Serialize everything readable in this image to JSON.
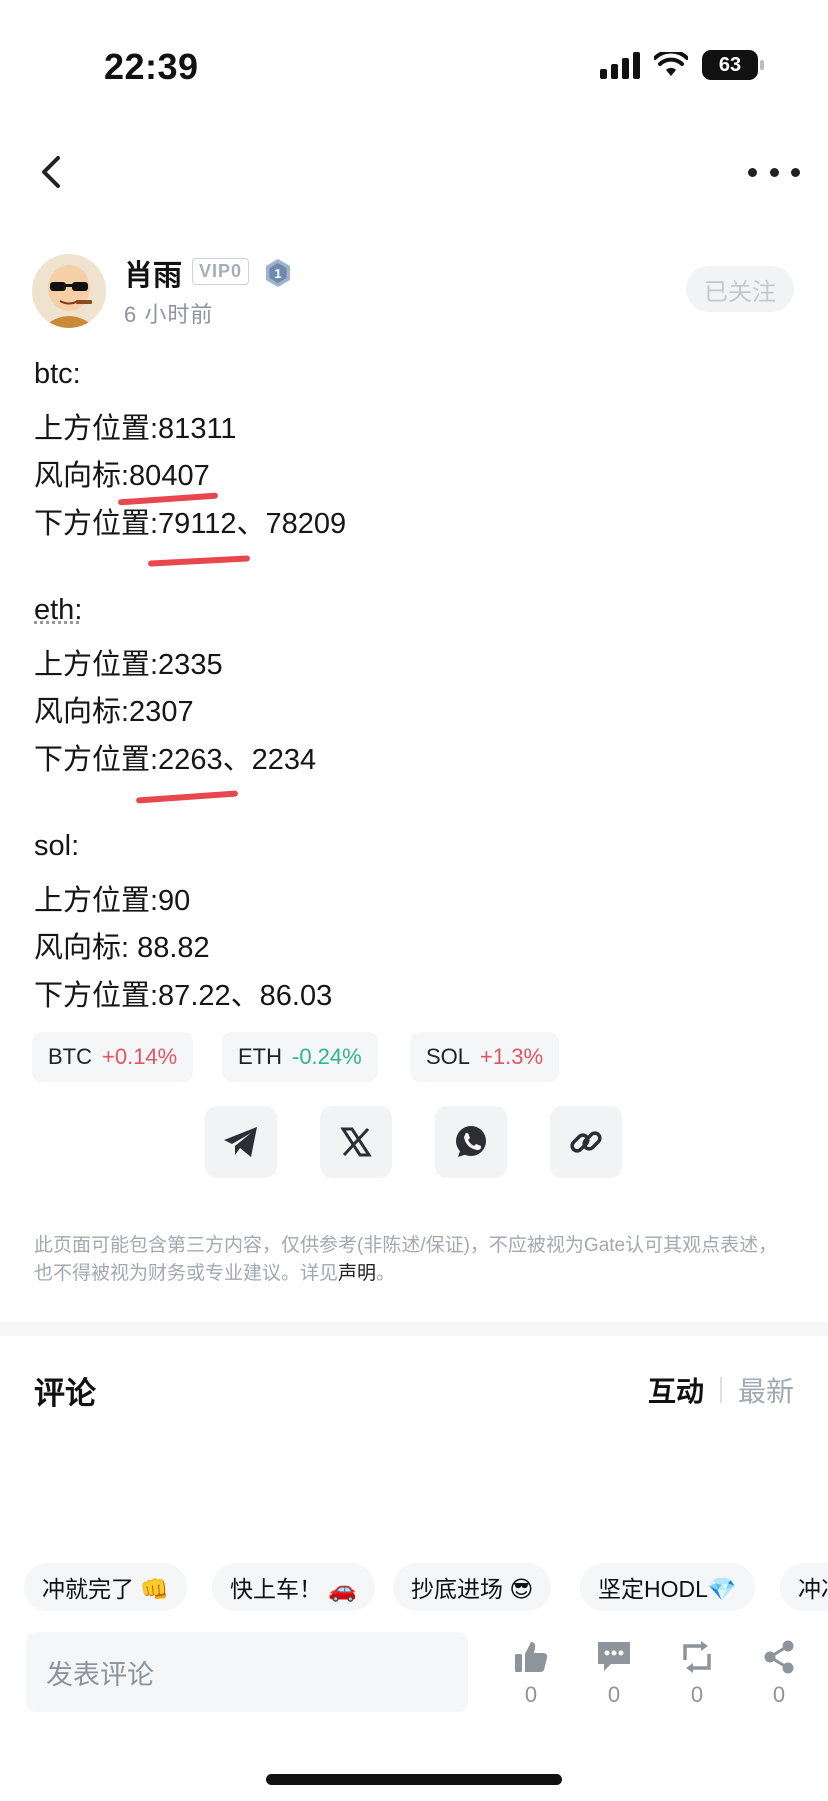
{
  "status_bar": {
    "time": "22:39",
    "battery": "63"
  },
  "author": {
    "name": "肖雨",
    "vip": "VIP0",
    "level": "1",
    "time": "6 小时前",
    "follow_label": "已关注"
  },
  "post": {
    "lines": [
      "btc:",
      "上方位置:81311",
      "风向标:80407",
      "下方位置:79112、78209",
      "eth:",
      "上方位置:2335",
      "风向标:2307",
      "下方位置:2263、2234",
      "sol:",
      "上方位置:90",
      "风向标: 88.82",
      "下方位置:87.22、86.03"
    ]
  },
  "tickers": [
    {
      "symbol": "BTC",
      "change": "+0.14%",
      "trend": "up"
    },
    {
      "symbol": "ETH",
      "change": "-0.24%",
      "trend": "down"
    },
    {
      "symbol": "SOL",
      "change": "+1.3%",
      "trend": "up"
    }
  ],
  "share": [
    "telegram-icon",
    "x-icon",
    "whatsapp-icon",
    "link-icon"
  ],
  "disclaimer": {
    "text": "此页面可能包含第三方内容，仅供参考(非陈述/保证)，不应被视为Gate认可其观点表述，也不得被视为财务或专业建议。详见",
    "link": "声明",
    "end": "。"
  },
  "comments": {
    "title": "评论",
    "sort_active": "互动",
    "sort_inactive": "最新"
  },
  "quick_replies": [
    "冲就完了 👊",
    "快上车！ 🚗",
    "抄底进场 😎",
    "坚定HODL💎",
    "冲冲冲"
  ],
  "input_placeholder": "发表评论",
  "actions": [
    {
      "icon": "thumbs-up-icon",
      "count": "0"
    },
    {
      "icon": "comment-icon",
      "count": "0"
    },
    {
      "icon": "repost-icon",
      "count": "0"
    },
    {
      "icon": "share-icon",
      "count": "0"
    }
  ],
  "colors": {
    "up": "#e05563",
    "down": "#2fb58c",
    "annotation": "#e8474e"
  }
}
